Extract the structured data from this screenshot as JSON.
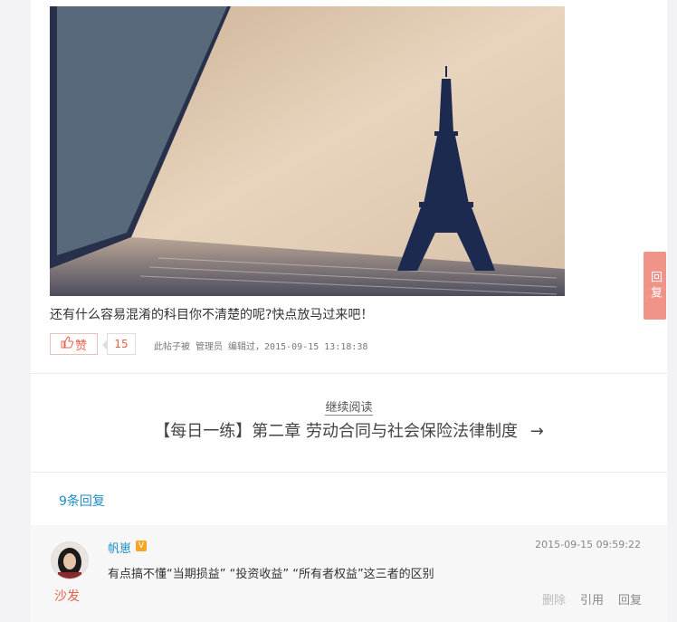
{
  "post": {
    "caption": "还有什么容易混淆的科目你不清楚的呢?快点放马过来吧！",
    "like_label": "赞",
    "like_count": "15",
    "edit_note": "此帖子被 管理员 编辑过，2015-09-15 13:18:38"
  },
  "continue_reading": {
    "label": "继续阅读",
    "next_title": "【每日一练】第二章 劳动合同与社会保险法律制度",
    "arrow": "→"
  },
  "replies": {
    "count_label": "9条回复",
    "items": [
      {
        "username": "帆崽",
        "badge": "V",
        "timestamp": "2015-09-15 09:59:22",
        "text": "有点搞不懂“当期损益”  “投资收益”  “所有者权益”这三者的区别",
        "floor": "沙发",
        "actions": {
          "delete": "删除",
          "quote": "引用",
          "reply": "回复"
        }
      }
    ]
  },
  "float_button": {
    "label": "回复"
  },
  "colors": {
    "accent_blue": "#1e8fc8",
    "accent_red": "#e8604c",
    "float_button": "#f0948a"
  },
  "icons": {
    "like": "thumbs-up-icon",
    "badge": "verified-badge-icon"
  }
}
